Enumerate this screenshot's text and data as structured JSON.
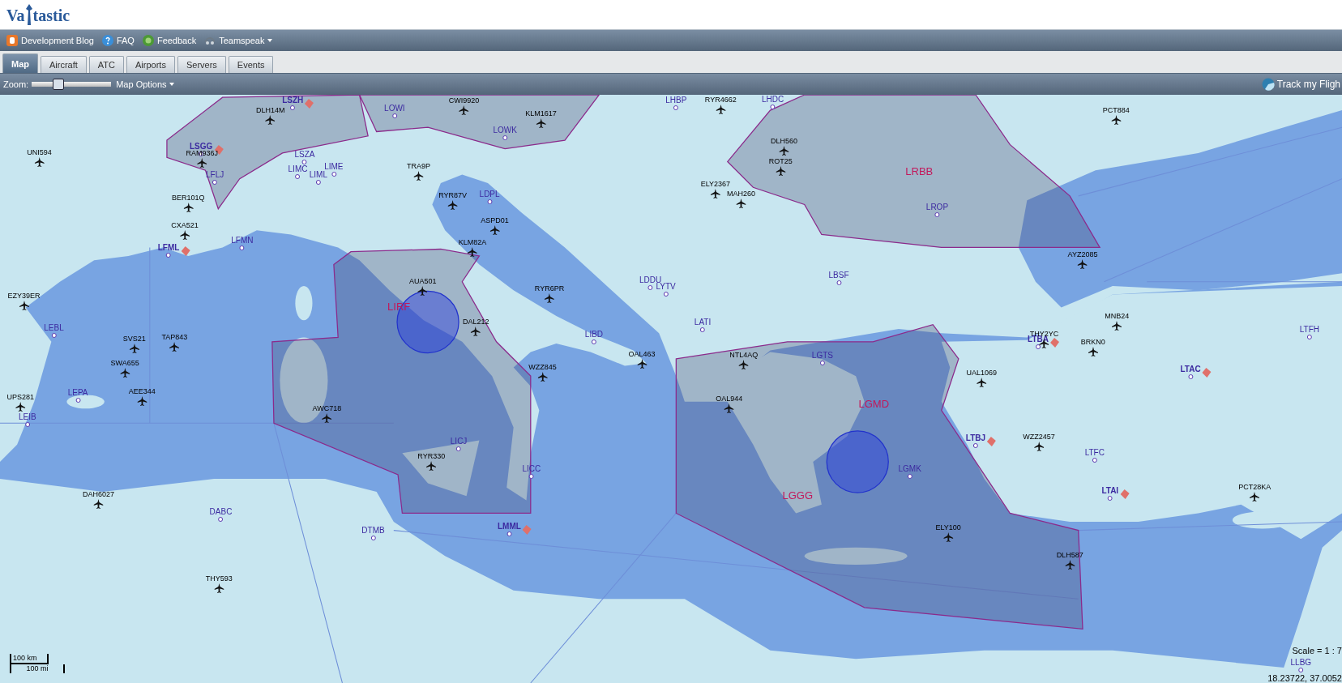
{
  "logo": {
    "left": "Va",
    "right": "tastic"
  },
  "nav_links": [
    {
      "label": "Development Blog",
      "kind": "blog"
    },
    {
      "label": "FAQ",
      "kind": "faq"
    },
    {
      "label": "Feedback",
      "kind": "feedback"
    },
    {
      "label": "Teamspeak",
      "kind": "teamspeak",
      "dropdown": true
    }
  ],
  "tabs": [
    {
      "label": "Map",
      "selected": true
    },
    {
      "label": "Aircraft",
      "selected": false
    },
    {
      "label": "ATC",
      "selected": false
    },
    {
      "label": "Airports",
      "selected": false
    },
    {
      "label": "Servers",
      "selected": false
    },
    {
      "label": "Events",
      "selected": false
    }
  ],
  "toolbar": {
    "zoom_label": "Zoom:",
    "zoom": {
      "level": 0.33
    },
    "map_options": "Map Options",
    "track": "Track my Fligh"
  },
  "aircraft": [
    {
      "callsign": "UNI594"
    },
    {
      "callsign": "DLH14M"
    },
    {
      "callsign": "CWI9920"
    },
    {
      "callsign": "KLM1617"
    },
    {
      "callsign": "RYR4662"
    },
    {
      "callsign": "PCT884"
    },
    {
      "callsign": "DLH560"
    },
    {
      "callsign": "ROT25"
    },
    {
      "callsign": "TRA9P"
    },
    {
      "callsign": "RYR87V"
    },
    {
      "callsign": "ELY2367"
    },
    {
      "callsign": "MAH260"
    },
    {
      "callsign": "BER101Q"
    },
    {
      "callsign": "CXA521"
    },
    {
      "callsign": "ASPD01"
    },
    {
      "callsign": "RAM936J"
    },
    {
      "callsign": "KLM82A"
    },
    {
      "callsign": "AYZ2085"
    },
    {
      "callsign": "EZY39ER"
    },
    {
      "callsign": "AUA501"
    },
    {
      "callsign": "RYR6PR"
    },
    {
      "callsign": "MNB24"
    },
    {
      "callsign": "THY2YC"
    },
    {
      "callsign": "BRKN0"
    },
    {
      "callsign": "SVS21"
    },
    {
      "callsign": "TAP843"
    },
    {
      "callsign": "SWA655"
    },
    {
      "callsign": "AEE344"
    },
    {
      "callsign": "UPS281"
    },
    {
      "callsign": "OAL463"
    },
    {
      "callsign": "WZZ845"
    },
    {
      "callsign": "NTL4AQ"
    },
    {
      "callsign": "UAL1069"
    },
    {
      "callsign": "OAL944"
    },
    {
      "callsign": "AWC718"
    },
    {
      "callsign": "WZZ2457"
    },
    {
      "callsign": "RYR330"
    },
    {
      "callsign": "DAH6027"
    },
    {
      "callsign": "PCT28KA"
    },
    {
      "callsign": "ELY100"
    },
    {
      "callsign": "DLH587"
    },
    {
      "callsign": "THY593"
    },
    {
      "callsign": "DAL212"
    }
  ],
  "airports": [
    {
      "code": "LSZH",
      "kind": "airport",
      "staffed": true
    },
    {
      "code": "LOWI",
      "kind": "airport",
      "staffed": false
    },
    {
      "code": "LOWK",
      "kind": "airport",
      "staffed": false
    },
    {
      "code": "LHBP",
      "kind": "airport",
      "staffed": false
    },
    {
      "code": "LHDC",
      "kind": "airport",
      "staffed": false
    },
    {
      "code": "LSGG",
      "kind": "airport",
      "staffed": true
    },
    {
      "code": "LSZA",
      "kind": "airport",
      "staffed": false
    },
    {
      "code": "LIMC",
      "kind": "airport",
      "staffed": false
    },
    {
      "code": "LIML",
      "kind": "airport",
      "staffed": false
    },
    {
      "code": "LIME",
      "kind": "airport",
      "staffed": false
    },
    {
      "code": "LFLJ",
      "kind": "airport",
      "staffed": false
    },
    {
      "code": "LFMN",
      "kind": "airport",
      "staffed": false
    },
    {
      "code": "LFML",
      "kind": "airport",
      "staffed": true
    },
    {
      "code": "LDPL",
      "kind": "airport",
      "staffed": false
    },
    {
      "code": "LRBB",
      "kind": "fir"
    },
    {
      "code": "LROP",
      "kind": "airport",
      "staffed": false
    },
    {
      "code": "LDDU",
      "kind": "airport",
      "staffed": false
    },
    {
      "code": "LYTV",
      "kind": "airport",
      "staffed": false
    },
    {
      "code": "LBSF",
      "kind": "airport",
      "staffed": false
    },
    {
      "code": "LIBD",
      "kind": "airport",
      "staffed": false
    },
    {
      "code": "LATI",
      "kind": "airport",
      "staffed": false
    },
    {
      "code": "LEBL",
      "kind": "airport",
      "staffed": false
    },
    {
      "code": "LEPA",
      "kind": "airport",
      "staffed": false
    },
    {
      "code": "LEIB",
      "kind": "airport",
      "staffed": false
    },
    {
      "code": "LIRF",
      "kind": "fir"
    },
    {
      "code": "LGTS",
      "kind": "airport",
      "staffed": false
    },
    {
      "code": "LGMD",
      "kind": "fir"
    },
    {
      "code": "LTBA",
      "kind": "airport",
      "staffed": true
    },
    {
      "code": "LTAC",
      "kind": "airport",
      "staffed": true
    },
    {
      "code": "LTFH",
      "kind": "airport",
      "staffed": false
    },
    {
      "code": "LTBJ",
      "kind": "airport",
      "staffed": true
    },
    {
      "code": "LTFC",
      "kind": "airport",
      "staffed": false
    },
    {
      "code": "LTAI",
      "kind": "airport",
      "staffed": true
    },
    {
      "code": "LICJ",
      "kind": "airport",
      "staffed": false
    },
    {
      "code": "LICC",
      "kind": "airport",
      "staffed": false
    },
    {
      "code": "LGGG",
      "kind": "fir"
    },
    {
      "code": "LGMK",
      "kind": "airport",
      "staffed": false
    },
    {
      "code": "LMML",
      "kind": "airport",
      "staffed": true
    },
    {
      "code": "DTMB",
      "kind": "airport",
      "staffed": false
    },
    {
      "code": "DABC",
      "kind": "airport",
      "staffed": false
    },
    {
      "code": "LLBG",
      "kind": "airport",
      "staffed": false
    }
  ],
  "scale_bar": {
    "km": "100 km",
    "mi": "100 mi"
  },
  "scale_text": "Scale = 1 : 7",
  "coordinates": "18.23722, 37.0052"
}
